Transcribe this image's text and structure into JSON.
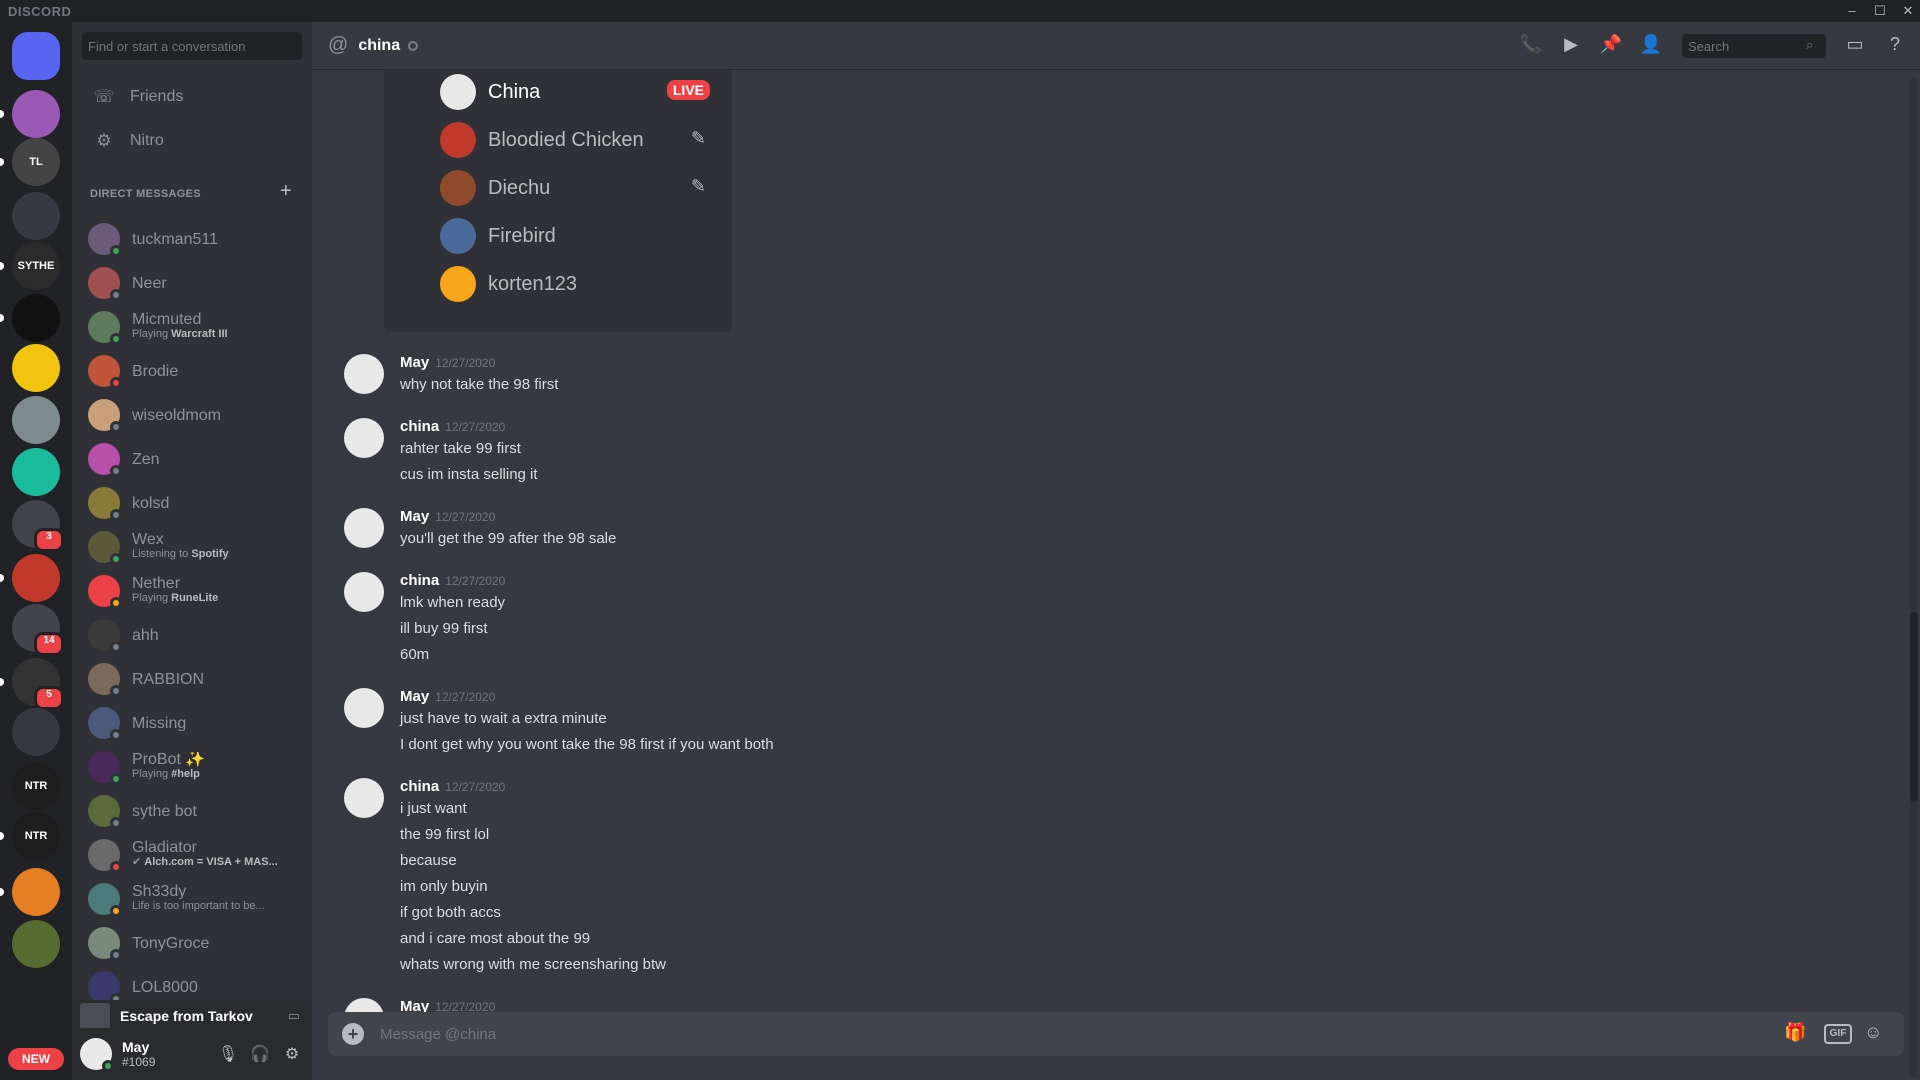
{
  "app": {
    "brand": "DISCORD"
  },
  "window_controls": [
    "–",
    "☐",
    "✕"
  ],
  "servers": [
    {
      "icon": "discord-home-icon",
      "color": "#5865f2",
      "label": "",
      "badge": "",
      "selected": true
    },
    {
      "icon": "skull-avatar-icon",
      "color": "#9b59b6",
      "label": "",
      "badge": ""
    },
    {
      "icon": "tl-logo-icon",
      "color": "#444",
      "label": "TL",
      "badge": ""
    },
    {
      "icon": "folder-icon",
      "color": "#36393f",
      "label": "",
      "badge": ""
    },
    {
      "icon": "sythe-logo-icon",
      "color": "#2b2b2b",
      "label": "SYTHE",
      "badge": ""
    },
    {
      "icon": "brand-logo-icon",
      "color": "#111",
      "label": "",
      "badge": ""
    },
    {
      "icon": "emblem-icon",
      "color": "#f1c40f",
      "label": "",
      "badge": ""
    },
    {
      "icon": "figure-icon",
      "color": "#7f8c8d",
      "label": "",
      "badge": ""
    },
    {
      "icon": "arrow-logo-icon",
      "color": "#1abc9c",
      "label": "",
      "badge": ""
    },
    {
      "icon": "group-folder-icon",
      "color": "#40444b",
      "label": "",
      "badge": "3"
    },
    {
      "icon": "red-shape-icon",
      "color": "#c0392b",
      "label": "",
      "badge": ""
    },
    {
      "icon": "group-folder-icon-2",
      "color": "#40444b",
      "label": "",
      "badge": "14"
    },
    {
      "icon": "dark-avatar-icon",
      "color": "#333",
      "label": "",
      "badge": "5"
    },
    {
      "icon": "pink-folder-icon",
      "color": "#36393f",
      "label": "",
      "badge": ""
    },
    {
      "icon": "ntr-logo-icon",
      "color": "#1e1e1e",
      "label": "NTR",
      "badge": ""
    },
    {
      "icon": "ntr-logo-icon-2",
      "color": "#1e1e1e",
      "label": "NTR",
      "badge": ""
    },
    {
      "icon": "bear-avatar-icon",
      "color": "#e67e22",
      "label": "",
      "badge": ""
    },
    {
      "icon": "soldier-avatar-icon",
      "color": "#556b2f",
      "label": "",
      "badge": ""
    }
  ],
  "new_badge": "NEW",
  "sidebar": {
    "search_placeholder": "Find or start a conversation",
    "friends": "Friends",
    "nitro": "Nitro",
    "dm_header": "DIRECT MESSAGES",
    "dms": [
      {
        "name": "tuckman511",
        "sub_pre": "",
        "sub_bold": "",
        "status": "online",
        "color": "#6c5a7a"
      },
      {
        "name": "Neer",
        "sub_pre": "",
        "sub_bold": "",
        "status": "offline",
        "color": "#a05050"
      },
      {
        "name": "Micmuted",
        "sub_pre": "Playing ",
        "sub_bold": "Warcraft III",
        "status": "online",
        "color": "#5d7a5d"
      },
      {
        "name": "Brodie",
        "sub_pre": "",
        "sub_bold": "",
        "status": "dnd",
        "color": "#c0553a"
      },
      {
        "name": "wiseoldmom",
        "sub_pre": "",
        "sub_bold": "",
        "status": "offline",
        "color": "#c9a07a"
      },
      {
        "name": "Zen",
        "sub_pre": "",
        "sub_bold": "",
        "status": "offline",
        "color": "#b84fa8"
      },
      {
        "name": "kolsd",
        "sub_pre": "",
        "sub_bold": "",
        "status": "offline",
        "color": "#8a7a3a"
      },
      {
        "name": "Wex",
        "sub_pre": "Listening to ",
        "sub_bold": "Spotify",
        "status": "online",
        "color": "#5a5a3a"
      },
      {
        "name": "Nether",
        "sub_pre": "Playing ",
        "sub_bold": "RuneLite",
        "status": "idle",
        "color": "#ed4245"
      },
      {
        "name": "ahh",
        "sub_pre": "",
        "sub_bold": "",
        "status": "offline",
        "color": "#3a3a3a"
      },
      {
        "name": "RABBION",
        "sub_pre": "",
        "sub_bold": "",
        "status": "offline",
        "color": "#7a6a5a"
      },
      {
        "name": "Missing",
        "sub_pre": "",
        "sub_bold": "",
        "status": "offline",
        "color": "#4a5a7a"
      },
      {
        "name": "ProBot ✨",
        "sub_pre": "Playing ",
        "sub_bold": "#help",
        "status": "online",
        "color": "#4a2a5a"
      },
      {
        "name": "sythe bot",
        "sub_pre": "",
        "sub_bold": "",
        "status": "offline",
        "color": "#5a6a3a"
      },
      {
        "name": "Gladiator",
        "sub_pre": "✔ ",
        "sub_bold": "Alch.com = VISA + MAS...",
        "status": "dnd",
        "color": "#6a6a6a"
      },
      {
        "name": "Sh33dy",
        "sub_pre": "Life is too important to be...",
        "sub_bold": "",
        "status": "idle",
        "color": "#4a7a7a"
      },
      {
        "name": "TonyGroce",
        "sub_pre": "",
        "sub_bold": "",
        "status": "offline",
        "color": "#7a8a7a"
      },
      {
        "name": "LOL8000",
        "sub_pre": "",
        "sub_bold": "",
        "status": "offline",
        "color": "#3a3a6a"
      }
    ],
    "activity_game": "Escape from Tarkov",
    "user": {
      "name": "May",
      "tag": "#1069"
    }
  },
  "header": {
    "channel": "china",
    "search_placeholder": "Search"
  },
  "call": {
    "live_label": "LIVE",
    "participants": [
      {
        "name": "China",
        "color": "#e8e8e8",
        "live": true,
        "muted": false
      },
      {
        "name": "Bloodied Chicken",
        "color": "#c0392b",
        "live": false,
        "muted": true
      },
      {
        "name": "Diechu",
        "color": "#8e4a2a",
        "live": false,
        "muted": true
      },
      {
        "name": "Firebird",
        "color": "#4a6a9a",
        "live": false,
        "muted": false
      },
      {
        "name": "korten123",
        "color": "#faa61a",
        "live": false,
        "muted": false
      }
    ]
  },
  "messages": [
    {
      "author": "May",
      "time": "12/27/2020",
      "lines": [
        "why not take the 98 first"
      ]
    },
    {
      "author": "china",
      "time": "12/27/2020",
      "lines": [
        "rahter take 99 first",
        "cus im insta selling it"
      ]
    },
    {
      "author": "May",
      "time": "12/27/2020",
      "lines": [
        "you'll get the 99 after the 98 sale"
      ]
    },
    {
      "author": "china",
      "time": "12/27/2020",
      "lines": [
        "lmk when ready",
        "ill buy 99 first",
        "60m"
      ]
    },
    {
      "author": "May",
      "time": "12/27/2020",
      "lines": [
        "just have to wait a extra minute",
        "I dont get why you wont take the 98 first if you want both"
      ]
    },
    {
      "author": "china",
      "time": "12/27/2020",
      "lines": [
        "i just want",
        "the 99 first lol",
        "because",
        "im only buyin",
        "if got both accs",
        "and i care most about the 99",
        "whats wrong with me screensharing btw"
      ]
    },
    {
      "author": "May",
      "time": "12/27/2020",
      "lines": []
    }
  ],
  "composer": {
    "placeholder": "Message @china",
    "gif": "GIF"
  },
  "colors": {
    "online": "#3ba55d",
    "idle": "#faa81a",
    "dnd": "#ed4245",
    "offline": "#747f8d"
  }
}
